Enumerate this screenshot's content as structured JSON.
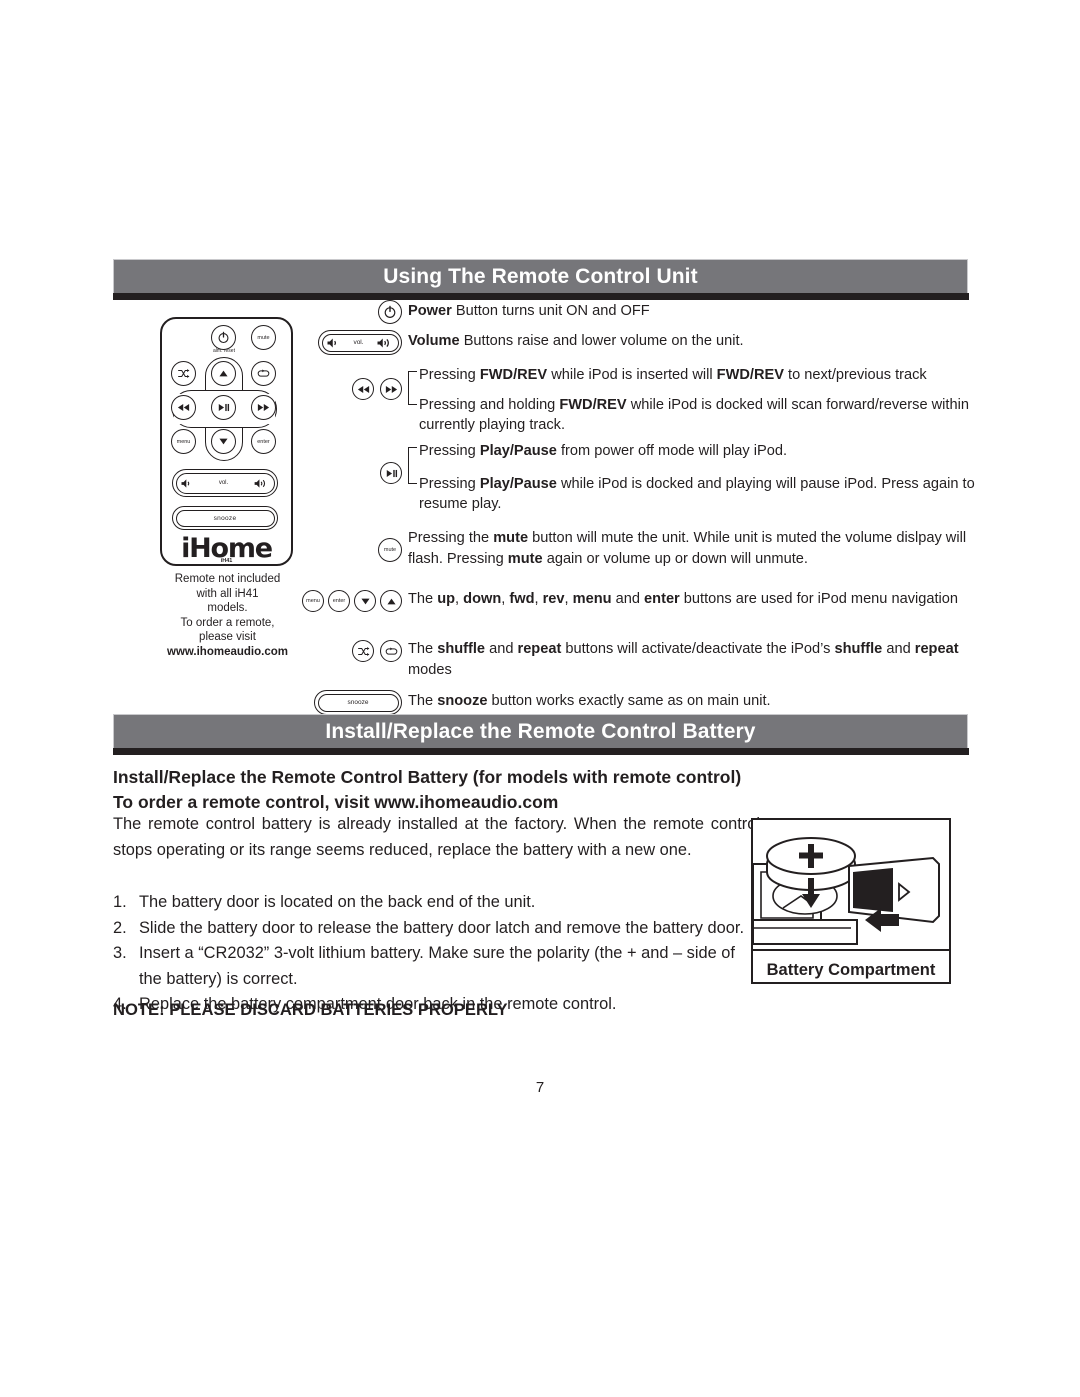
{
  "page": {
    "number": "7"
  },
  "sections": {
    "remote": {
      "banner_title": "Using The Remote Control Unit",
      "note": {
        "line1": "Remote not included",
        "line2": "with all iH41",
        "line3": "models.",
        "line4": "To order a remote,",
        "line5": "please visit",
        "url": "www.ihomeaudio.com"
      },
      "device": {
        "logo": "iHome",
        "model": "iH41",
        "alm_reset_label": "alm. reset",
        "buttons": {
          "power": "power-icon",
          "mute": "mute",
          "shuffle": "shuffle-icon",
          "repeat": "repeat-icon",
          "up": "up-arrow-icon",
          "down": "down-arrow-icon",
          "rev": "rewind-icon",
          "fwd": "fast-forward-icon",
          "play_pause": "play-pause-icon",
          "menu": "menu",
          "enter": "enter",
          "vol_label": "vol.",
          "snooze": "snooze"
        }
      },
      "rows": [
        {
          "id": "power",
          "icons": [
            "power"
          ],
          "lines": [
            [
              {
                "t": "Power",
                "b": true
              },
              {
                "t": " Button turns unit ON and OFF",
                "b": false
              }
            ]
          ]
        },
        {
          "id": "volume",
          "icons": [
            "volume-pill"
          ],
          "lines": [
            [
              {
                "t": "Volume",
                "b": true
              },
              {
                "t": " Buttons raise and lower volume on the unit.",
                "b": false
              }
            ]
          ]
        },
        {
          "id": "fwd-rev",
          "icons": [
            "rev",
            "fwd"
          ],
          "bracket": true,
          "lines": [
            [
              {
                "t": "Pressing ",
                "b": false
              },
              {
                "t": "FWD/REV",
                "b": true
              },
              {
                "t": " while iPod is inserted will ",
                "b": false
              },
              {
                "t": "FWD/REV",
                "b": true
              },
              {
                "t": " to next/previous track",
                "b": false
              }
            ],
            [
              {
                "t": "Pressing and holding ",
                "b": false
              },
              {
                "t": "FWD/REV",
                "b": true
              },
              {
                "t": " while iPod is docked will scan forward/reverse within currently playing track.",
                "b": false
              }
            ]
          ]
        },
        {
          "id": "play-pause",
          "icons": [
            "play-pause"
          ],
          "bracket": true,
          "lines": [
            [
              {
                "t": "Pressing ",
                "b": false
              },
              {
                "t": "Play/Pause",
                "b": true
              },
              {
                "t": " from power off mode will play iPod.",
                "b": false
              }
            ],
            [
              {
                "t": "Pressing ",
                "b": false
              },
              {
                "t": "Play/Pause",
                "b": true
              },
              {
                "t": " while iPod is docked and playing will pause iPod. Press again to resume play.",
                "b": false
              }
            ]
          ]
        },
        {
          "id": "mute",
          "icons": [
            "mute"
          ],
          "lines": [
            [
              {
                "t": "Pressing the ",
                "b": false
              },
              {
                "t": "mute",
                "b": true
              },
              {
                "t": " button will mute the unit.  While unit is muted the volume dislpay will flash. Pressing ",
                "b": false
              },
              {
                "t": "mute",
                "b": true
              },
              {
                "t": " again or volume up or down will unmute.",
                "b": false
              }
            ]
          ]
        },
        {
          "id": "navigation",
          "icons": [
            "menu",
            "enter",
            "down",
            "up"
          ],
          "lines": [
            [
              {
                "t": "The ",
                "b": false
              },
              {
                "t": "up",
                "b": true
              },
              {
                "t": ", ",
                "b": false
              },
              {
                "t": "down",
                "b": true
              },
              {
                "t": ", ",
                "b": false
              },
              {
                "t": "fwd",
                "b": true
              },
              {
                "t": ", ",
                "b": false
              },
              {
                "t": "rev",
                "b": true
              },
              {
                "t": ", ",
                "b": false
              },
              {
                "t": "menu",
                "b": true
              },
              {
                "t": " and ",
                "b": false
              },
              {
                "t": "enter",
                "b": true
              },
              {
                "t": " buttons are used for iPod menu navigation",
                "b": false
              }
            ]
          ]
        },
        {
          "id": "shuffle-repeat",
          "icons": [
            "shuffle",
            "repeat"
          ],
          "lines": [
            [
              {
                "t": "The ",
                "b": false
              },
              {
                "t": "shuffle",
                "b": true
              },
              {
                "t": " and ",
                "b": false
              },
              {
                "t": "repeat",
                "b": true
              },
              {
                "t": " buttons will activate/deactivate the iPod’s ",
                "b": false
              },
              {
                "t": "shuffle",
                "b": true
              },
              {
                "t": " and ",
                "b": false
              },
              {
                "t": "repeat",
                "b": true
              },
              {
                "t": " modes",
                "b": false
              }
            ]
          ]
        },
        {
          "id": "snooze",
          "icons": [
            "snooze-pill"
          ],
          "lines": [
            [
              {
                "t": "The ",
                "b": false
              },
              {
                "t": "snooze",
                "b": true
              },
              {
                "t": " button works exactly same as on main unit.",
                "b": false
              }
            ]
          ]
        }
      ]
    },
    "battery": {
      "banner_title": "Install/Replace the Remote Control Battery",
      "sub_head_line1": "Install/Replace the Remote Control Battery (for models with remote control)",
      "sub_head_line2": "To order a remote control, visit www.ihomeaudio.com",
      "intro": "The remote control battery is already installed at the factory. When the remote control stops operating or its range seems reduced, replace the battery with a new one.",
      "steps": [
        {
          "num": "1.",
          "text": "The battery door is located on the back end of the unit."
        },
        {
          "num": "2.",
          "text": "Slide the battery door to release the battery door latch and remove the battery door."
        },
        {
          "num": "3.",
          "text": "Insert a “CR2032” 3-volt lithium battery. Make sure the polarity (the + and – side of the battery) is correct."
        },
        {
          "num": "4.",
          "text": "Replace the battery compartment door back in the remote control."
        }
      ],
      "note": "NOTE: PLEASE DISCARD BATTERIES PROPERLY",
      "figure": {
        "caption": "Battery Compartment",
        "battery_polarity": "+"
      }
    }
  },
  "colors": {
    "banner_bg": "#76767a",
    "banner_rule": "#231f20",
    "text": "#231f20",
    "banner_text": "#ffffff"
  }
}
